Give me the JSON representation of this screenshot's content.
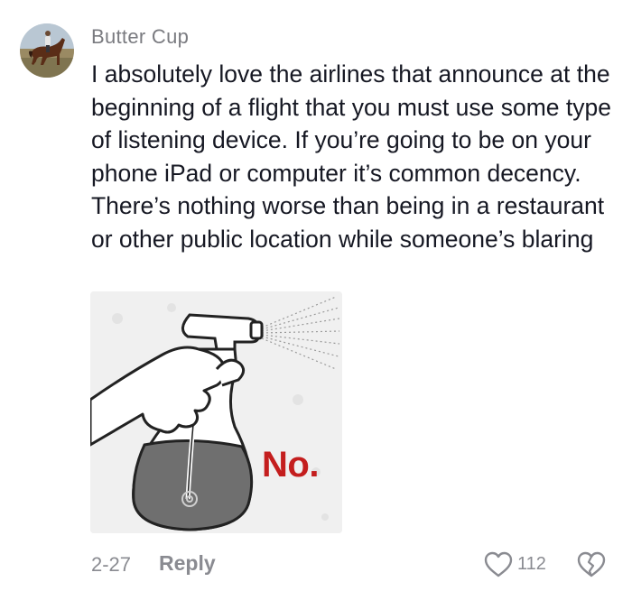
{
  "comment": {
    "username": "Butter Cup",
    "text": "I absolutely love the airlines that announce at the beginning of a flight that you must use some type of listening device. If you’re going to be on your phone iPad or computer it’s common decency. There’s nothing worse than being in a restaurant or other public location while someone’s blaring",
    "attachment": {
      "icon": "spray-bottle-icon",
      "caption": "No."
    },
    "date": "2-27",
    "reply_label": "Reply",
    "like_count": "112",
    "icons": {
      "like": "heart-outline-icon",
      "dislike": "broken-heart-icon",
      "avatar": "horse-rider-photo"
    },
    "colors": {
      "text": "#161823",
      "muted": "#8a8b91",
      "no_label": "#c41e1e"
    }
  }
}
